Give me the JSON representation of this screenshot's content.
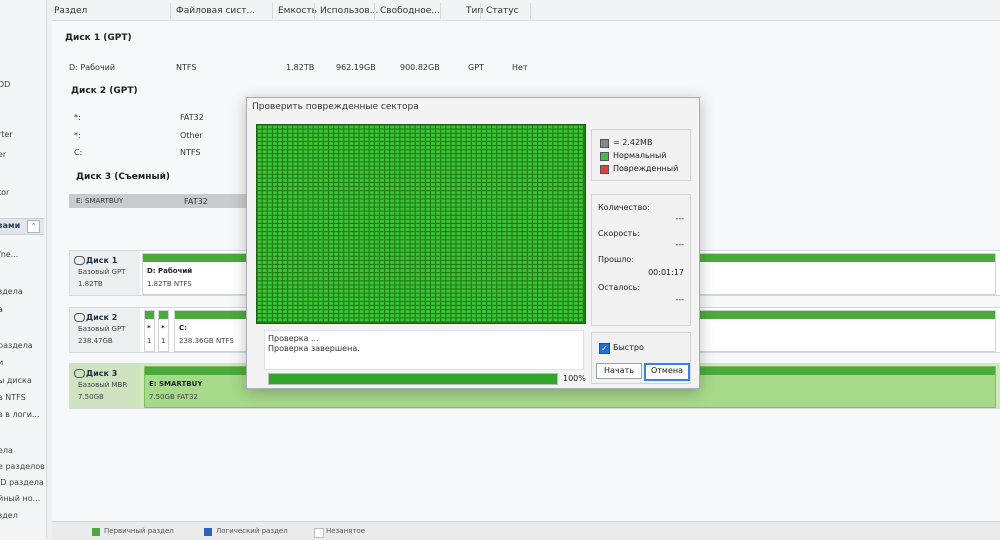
{
  "sidebar": {
    "items": [
      "",
      "",
      "",
      "DD",
      "",
      "rter",
      "er",
      "",
      "tor"
    ],
    "section_label": "зами",
    "items2": [
      "/ne...",
      "",
      "здела",
      "а",
      "",
      "раздела",
      "и",
      "ы диска",
      "в NTFS",
      "в в логи...",
      "",
      "ела",
      "",
      "е разделов",
      "ID раздела",
      "йный но...",
      "здел"
    ]
  },
  "columns": {
    "partition": "Раздел",
    "fs": "Файловая сист...",
    "capacity": "Емкость",
    "used": "Использов...",
    "free": "Свободное...",
    "type": "Тип",
    "status": "Статус"
  },
  "disks": [
    {
      "header": "Диск 1 (GPT)",
      "rows": [
        {
          "partition": "D: Рабочий",
          "fs": "NTFS",
          "capacity": "1.82TB",
          "used": "962.19GB",
          "free": "900.82GB",
          "type": "GPT",
          "status": "Нет"
        }
      ]
    },
    {
      "header": "Диск 2 (GPT)",
      "rows": [
        {
          "partition": "*:",
          "fs": "FAT32"
        },
        {
          "partition": "*:",
          "fs": "Other"
        },
        {
          "partition": "C:",
          "fs": "NTFS"
        }
      ]
    },
    {
      "header": "Диск 3 (Съемный)",
      "rows": [
        {
          "partition": "E: SMARTBUY",
          "fs": "FAT32"
        }
      ]
    }
  ],
  "disk_map": [
    {
      "name": "Диск 1",
      "type": "Базовый GPT",
      "size": "1.82TB",
      "parts": [
        {
          "label": "D: Рабочий",
          "size": "1.82TB NTFS"
        }
      ]
    },
    {
      "name": "Диск 2",
      "type": "Базовый GPT",
      "size": "238.47GB",
      "parts": [
        {
          "label": "*",
          "size": "1"
        },
        {
          "label": "*",
          "size": "1"
        },
        {
          "label": "C:",
          "size": "238.36GB NTFS"
        }
      ]
    },
    {
      "name": "Диск 3",
      "type": "Базовый MBR",
      "size": "7.50GB",
      "parts": [
        {
          "label": "E: SMARTBUY",
          "size": "7.50GB FAT32"
        }
      ]
    }
  ],
  "legend_bar": {
    "primary": "Первичный раздел",
    "logical": "Логический раздел",
    "unallocated": "Незанятое",
    "primary_color": "#4caa3c",
    "logical_color": "#2f5fbf"
  },
  "dialog": {
    "title": "Проверить поврежденные сектора",
    "legend": {
      "block_size": "= 2.42MB",
      "normal": "Нормальный",
      "damaged": "Поврежденный",
      "normal_color": "#3cc23a",
      "damaged_color": "#d9413b"
    },
    "stats": {
      "count_label": "Количество:",
      "count_value": "---",
      "speed_label": "Скорость:",
      "speed_value": "---",
      "elapsed_label": "Прошло:",
      "elapsed_value": "00:01:17",
      "remaining_label": "Осталось:",
      "remaining_value": "---"
    },
    "log": [
      "Проверка ...",
      "Проверка завершена."
    ],
    "progress": {
      "value": 100,
      "label": "100%"
    },
    "quick_label": "Быстро",
    "quick_checked": true,
    "start_label": "Начать",
    "cancel_label": "Отмена"
  }
}
